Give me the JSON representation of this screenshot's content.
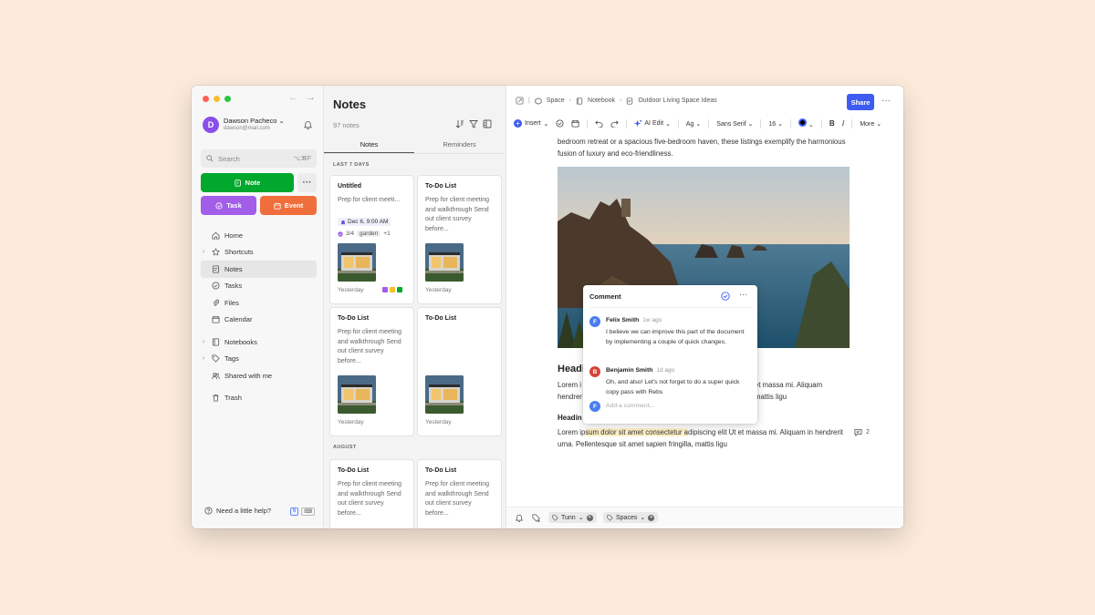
{
  "window": {
    "nav_back": "←",
    "nav_forward": "→"
  },
  "account": {
    "initial": "D",
    "name": "Dawson Pacheco",
    "caret": "⌄",
    "email": "dawson@mail.com"
  },
  "sidebar": {
    "search_placeholder": "Search",
    "search_shortcut": "⌥⌘F",
    "note_button": "Note",
    "more_button": "···",
    "task_button": "Task",
    "event_button": "Event",
    "items": [
      {
        "label": "Home",
        "icon": "home-icon"
      },
      {
        "label": "Shortcuts",
        "icon": "star-icon",
        "caret": "›"
      },
      {
        "label": "Notes",
        "icon": "note-icon",
        "active": true
      },
      {
        "label": "Tasks",
        "icon": "check-circle-icon"
      },
      {
        "label": "Files",
        "icon": "paperclip-icon"
      },
      {
        "label": "Calendar",
        "icon": "calendar-icon"
      },
      {
        "label": "Notebooks",
        "icon": "notebook-icon",
        "caret": "›"
      },
      {
        "label": "Tags",
        "icon": "tag-icon",
        "caret": "›"
      },
      {
        "label": "Shared with me",
        "icon": "people-icon"
      },
      {
        "label": "Trash",
        "icon": "trash-icon"
      }
    ],
    "help_label": "Need a little help?",
    "help_badge_1": "6",
    "help_badge_2": "⌨"
  },
  "notes_list": {
    "title": "Notes",
    "count": "97 notes",
    "tabs": [
      "Notes",
      "Reminders"
    ],
    "section_1": "LAST 7 DAYS",
    "section_2": "AUGUST",
    "cards": [
      {
        "title": "Untitled",
        "body": "Prep for client meeti...",
        "reminder": "Dec 6, 9:00 AM",
        "tasks": "3/4",
        "tag": "garden",
        "tag_more": "+1",
        "date": "Yesterday"
      },
      {
        "title": "To-Do List",
        "body": "Prep for client meeting and walkthrough Send out client survey before...",
        "date": "Yesterday"
      },
      {
        "title": "To-Do List",
        "body": "Prep for client meeting and walkthrough Send out client survey before...",
        "date": "Yesterday"
      },
      {
        "title": "To-Do List",
        "body": "",
        "date": "Yesterday"
      },
      {
        "title": "To-Do List",
        "body": "Prep for client meeting and walkthrough Send out client survey before..."
      },
      {
        "title": "To-Do List",
        "body": "Prep for client meeting and walkthrough Send out client survey before..."
      }
    ]
  },
  "editor": {
    "breadcrumbs": [
      "Space",
      "Notebook",
      "Outdoor Living Space Ideas"
    ],
    "share_button": "Share",
    "more": "···",
    "toolbar": {
      "insert": "Insert",
      "ai_edit": "AI Edit",
      "text_style": "Ag",
      "font": "Sans Serif",
      "size": "16",
      "bold": "B",
      "italic": "I",
      "more": "More"
    },
    "para1": "bedroom retreat or a spacious five-bedroom haven, these listings exemplify the harmonious fusion of luxury and eco-friendliness.",
    "heading1": "Headi",
    "para2_left": "Lorem i\nhendrer",
    "para2_right": "et massa mi. Aliquam\nmattis ligu",
    "heading2": "Headin",
    "para3_pre": "Lorem ip",
    "para3_hl": "sum dolor sit amet consectetur a",
    "para3_post": "dipiscing elit Ut et massa mi. Aliquam in hendrerit urna. Pellentesque sit amet sapien fringilla, mattis ligu",
    "comment_count": "2"
  },
  "comment_popup": {
    "title": "Comment",
    "comments": [
      {
        "initial": "F",
        "author": "Felix Smith",
        "time": "1w ago",
        "text": "I believe we can improve this part of the document by implementing a couple of quick changes.",
        "color": "#4a7cf0"
      },
      {
        "initial": "B",
        "author": "Benjamin Smith",
        "time": "1d ago",
        "text": "Oh, and also! Let's not forget to do a super quick copy pass with Rebs",
        "color": "#d2453c"
      }
    ],
    "input_initial": "F",
    "input_placeholder": "Add a comment..."
  },
  "bottombar": {
    "chip_1": "Tunn",
    "chip_2": "Spaces"
  },
  "colors": {
    "green": "#00a82d",
    "purple": "#a25ee8",
    "orange": "#f06e3b",
    "blue": "#3e5cf1"
  }
}
